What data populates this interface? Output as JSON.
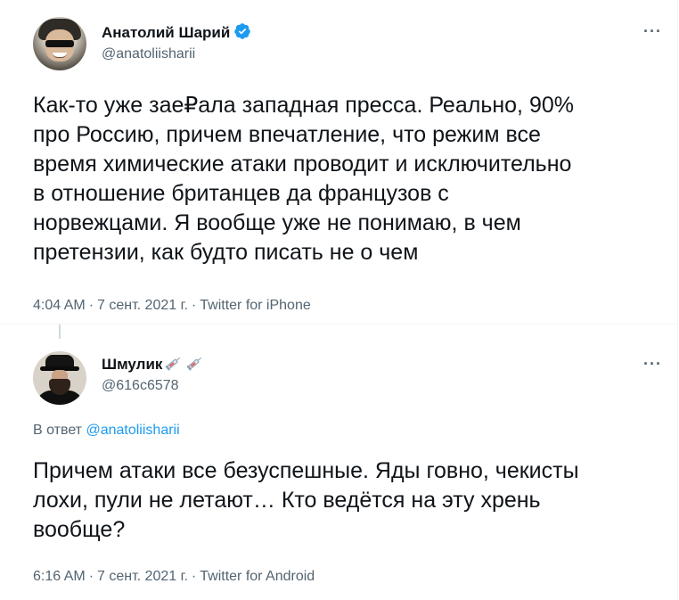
{
  "tweet1": {
    "author_name": "Анатолий Шарий",
    "handle": "@anatoliisharii",
    "text": "Как-то уже зае₽ала западная пресса. Реально, 90%\nпро Россию, причем впечатление, что режим все\nвремя химические атаки проводит и исключительно\nв отношение британцев да французов с\nнорвежцами. Я вообще уже не понимаю, в чем\nпретензии, как будто писать не о чем",
    "time": "4:04 AM",
    "date": "7 сент. 2021 г.",
    "source": "Twitter for iPhone",
    "more": "···"
  },
  "tweet2": {
    "author_name": "Шмулик",
    "handle": "@616c6578",
    "reply_prefix": "В ответ",
    "reply_handle": "@anatoliisharii",
    "text": "Причем атаки все безуспешные. Яды говно, чекисты\nлохи, пули не летают… Кто ведётся на эту хрень\nвообще?",
    "time": "6:16 AM",
    "date": "7 сент. 2021 г.",
    "source": "Twitter for Android",
    "more": "···"
  },
  "separator": "·",
  "colors": {
    "text": "#0f1419",
    "secondary": "#536471",
    "accent": "#1d9bf0",
    "border": "#eff3f4"
  },
  "icons": [
    "verified-badge-icon",
    "syringe-emoji-icon",
    "more-icon"
  ]
}
